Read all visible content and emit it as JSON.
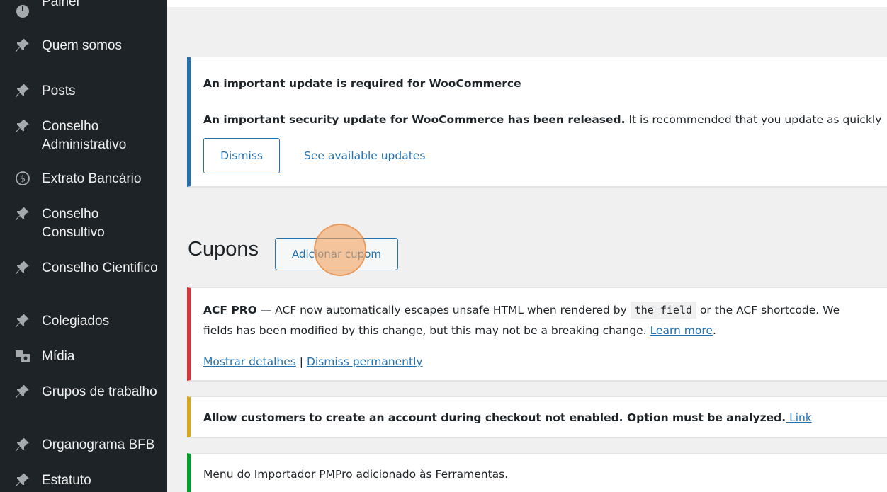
{
  "sidebar": {
    "items": [
      {
        "label": "Painel",
        "icon": "dashboard-icon"
      },
      {
        "label": "Quem somos",
        "icon": "pin-icon"
      },
      {
        "label": "Posts",
        "icon": "pin-icon"
      },
      {
        "label": "Conselho Administrativo",
        "icon": "pin-icon"
      },
      {
        "label": "Extrato Bancário",
        "icon": "dollar-icon"
      },
      {
        "label": "Conselho Consultivo",
        "icon": "pin-icon"
      },
      {
        "label": "Conselho Cientifico",
        "icon": "pin-icon"
      },
      {
        "label": "Colegiados",
        "icon": "pin-icon"
      },
      {
        "label": "Mídia",
        "icon": "media-icon"
      },
      {
        "label": "Grupos de trabalho",
        "icon": "pin-icon"
      },
      {
        "label": "Organograma BFB",
        "icon": "pin-icon"
      },
      {
        "label": "Estatuto",
        "icon": "pin-icon"
      }
    ]
  },
  "notices": {
    "woo": {
      "title": "An important update is required for WooCommerce",
      "text_bold": "An important security update for WooCommerce has been released.",
      "text_rest": " It is recommended that you update as quickly",
      "dismiss": "Dismiss",
      "see_updates": "See available updates"
    },
    "acf": {
      "prefix_bold": "ACF PRO",
      "text1": " — ACF now automatically escapes unsafe HTML when rendered by ",
      "code": "the_field",
      "text2": " or the ACF shortcode. We",
      "line2": "fields has been modified by this change, but this may not be a breaking change. ",
      "learn_more": "Learn more",
      "period": ".",
      "show_details": "Mostrar detalhes",
      "separator": " | ",
      "dismiss_permanently": "Dismiss permanently"
    },
    "checkout": {
      "text": "Allow customers to create an account during checkout not enabled. Option must be analyzed.",
      "link": " Link"
    },
    "pmpro": {
      "text": "Menu do Importador PMPro adicionado às Ferramentas."
    }
  },
  "page": {
    "title": "Cupons",
    "add_button": "Adicionar cupom"
  },
  "colors": {
    "sidebar_bg": "#1d2327",
    "accent": "#2271b1",
    "error": "#d63638",
    "warning": "#dba617",
    "success": "#00a32a"
  }
}
